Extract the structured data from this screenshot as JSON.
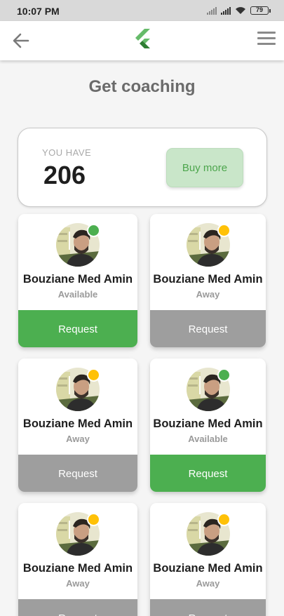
{
  "status_bar": {
    "time": "10:07 PM",
    "battery": "79"
  },
  "app_bar": {
    "back_icon": "arrow-left-icon",
    "logo_icon": "flutter-logo-icon",
    "menu_icon": "hamburger-menu-icon"
  },
  "page": {
    "title": "Get coaching"
  },
  "balance": {
    "label": "YOU HAVE",
    "value": "206",
    "buy_label": "Buy more"
  },
  "colors": {
    "available": "#4caf50",
    "away": "#ffc107",
    "request_available": "#4caf50",
    "request_away": "#9e9e9e"
  },
  "coaches": [
    {
      "name": "Bouziane Med Amin",
      "status": "Available",
      "request_label": "Request"
    },
    {
      "name": "Bouziane Med Amin",
      "status": "Away",
      "request_label": "Request"
    },
    {
      "name": "Bouziane Med Amin",
      "status": "Away",
      "request_label": "Request"
    },
    {
      "name": "Bouziane Med Amin",
      "status": "Available",
      "request_label": "Request"
    },
    {
      "name": "Bouziane Med Amin",
      "status": "Away",
      "request_label": "Request"
    },
    {
      "name": "Bouziane Med Amin",
      "status": "Away",
      "request_label": "Request"
    }
  ]
}
